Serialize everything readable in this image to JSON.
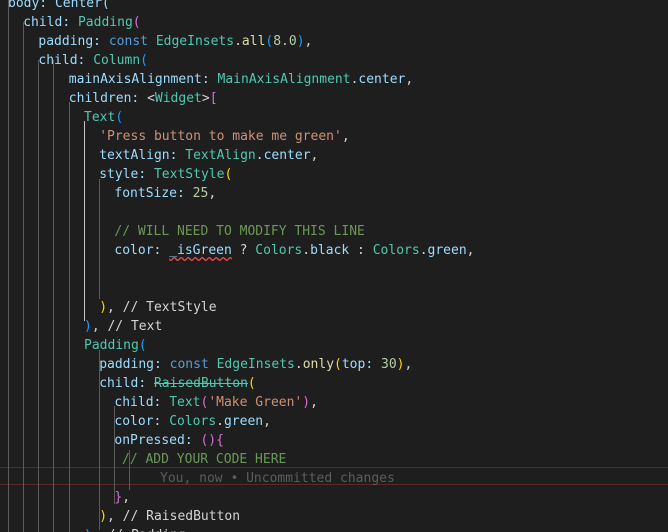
{
  "editor": {
    "language": "dart",
    "blame_annotation": "You, now • Uncommitted changes",
    "lines": [
      [
        {
          "t": "body: Center(",
          "c": "tok-prop"
        }
      ],
      [
        {
          "t": "child: ",
          "c": "tok-prop"
        },
        {
          "t": "Padding",
          "c": "tok-cls"
        },
        {
          "t": "(",
          "c": "tok-br2"
        }
      ],
      [
        {
          "t": "padding: ",
          "c": "tok-prop"
        },
        {
          "t": "const ",
          "c": "tok-kw"
        },
        {
          "t": "EdgeInsets",
          "c": "tok-cls"
        },
        {
          "t": ".",
          "c": "tok-punc"
        },
        {
          "t": "all",
          "c": "tok-fn"
        },
        {
          "t": "(",
          "c": "tok-br3"
        },
        {
          "t": "8.0",
          "c": "tok-num"
        },
        {
          "t": ")",
          "c": "tok-br3"
        },
        {
          "t": ",",
          "c": "tok-punc"
        }
      ],
      [
        {
          "t": "child: ",
          "c": "tok-prop"
        },
        {
          "t": "Column",
          "c": "tok-cls"
        },
        {
          "t": "(",
          "c": "tok-br3"
        }
      ],
      [
        {
          "t": "mainAxisAlignment: ",
          "c": "tok-prop"
        },
        {
          "t": "MainAxisAlignment",
          "c": "tok-cls"
        },
        {
          "t": ".",
          "c": "tok-punc"
        },
        {
          "t": "center",
          "c": "tok-prop"
        },
        {
          "t": ",",
          "c": "tok-punc"
        }
      ],
      [
        {
          "t": "children: ",
          "c": "tok-prop"
        },
        {
          "t": "<",
          "c": "tok-punc"
        },
        {
          "t": "Widget",
          "c": "tok-cls"
        },
        {
          "t": ">",
          "c": "tok-punc"
        },
        {
          "t": "[",
          "c": "tok-br2"
        }
      ],
      [
        {
          "t": "Text",
          "c": "tok-cls"
        },
        {
          "t": "(",
          "c": "tok-br3"
        }
      ],
      [
        {
          "t": "'Press button to make me green'",
          "c": "tok-str"
        },
        {
          "t": ",",
          "c": "tok-punc"
        }
      ],
      [
        {
          "t": "textAlign: ",
          "c": "tok-prop"
        },
        {
          "t": "TextAlign",
          "c": "tok-cls"
        },
        {
          "t": ".",
          "c": "tok-punc"
        },
        {
          "t": "center",
          "c": "tok-prop"
        },
        {
          "t": ",",
          "c": "tok-punc"
        }
      ],
      [
        {
          "t": "style: ",
          "c": "tok-prop"
        },
        {
          "t": "TextStyle",
          "c": "tok-cls"
        },
        {
          "t": "(",
          "c": "tok-br1"
        }
      ],
      [
        {
          "t": "fontSize: ",
          "c": "tok-prop"
        },
        {
          "t": "25",
          "c": "tok-num"
        },
        {
          "t": ",",
          "c": "tok-punc"
        }
      ],
      [],
      [
        {
          "t": "// WILL NEED TO MODIFY THIS LINE",
          "c": "tok-cmt"
        }
      ],
      [
        {
          "t": "color: ",
          "c": "tok-prop"
        },
        {
          "t": "_isGreen",
          "c": "tok-prop tok-err"
        },
        {
          "t": " ? ",
          "c": "tok-punc"
        },
        {
          "t": "Colors",
          "c": "tok-cls"
        },
        {
          "t": ".",
          "c": "tok-punc"
        },
        {
          "t": "black",
          "c": "tok-prop"
        },
        {
          "t": " : ",
          "c": "tok-punc"
        },
        {
          "t": "Colors",
          "c": "tok-cls"
        },
        {
          "t": ".",
          "c": "tok-punc"
        },
        {
          "t": "green",
          "c": "tok-prop"
        },
        {
          "t": ",",
          "c": "tok-punc"
        }
      ],
      [],
      [],
      [
        {
          "t": ")",
          "c": "tok-br1"
        },
        {
          "t": ", // TextStyle",
          "c": "tok-punc"
        }
      ],
      [
        {
          "t": ")",
          "c": "tok-br3"
        },
        {
          "t": ", // Text",
          "c": "tok-punc"
        }
      ],
      [
        {
          "t": "Padding",
          "c": "tok-cls"
        },
        {
          "t": "(",
          "c": "tok-br3"
        }
      ],
      [
        {
          "t": "padding: ",
          "c": "tok-prop"
        },
        {
          "t": "const ",
          "c": "tok-kw"
        },
        {
          "t": "EdgeInsets",
          "c": "tok-cls"
        },
        {
          "t": ".",
          "c": "tok-punc"
        },
        {
          "t": "only",
          "c": "tok-fn"
        },
        {
          "t": "(",
          "c": "tok-br1"
        },
        {
          "t": "top: ",
          "c": "tok-prop"
        },
        {
          "t": "30",
          "c": "tok-num"
        },
        {
          "t": ")",
          "c": "tok-br1"
        },
        {
          "t": ",",
          "c": "tok-punc"
        }
      ],
      [
        {
          "t": "child: ",
          "c": "tok-prop"
        },
        {
          "t": "RaisedButton",
          "c": "tok-cls tok-strike tok-warn"
        },
        {
          "t": "(",
          "c": "tok-br1"
        }
      ],
      [
        {
          "t": "child: ",
          "c": "tok-prop"
        },
        {
          "t": "Text",
          "c": "tok-cls"
        },
        {
          "t": "(",
          "c": "tok-br2"
        },
        {
          "t": "'Make Green'",
          "c": "tok-str"
        },
        {
          "t": ")",
          "c": "tok-br2"
        },
        {
          "t": ",",
          "c": "tok-punc"
        }
      ],
      [
        {
          "t": "color: ",
          "c": "tok-prop"
        },
        {
          "t": "Colors",
          "c": "tok-cls"
        },
        {
          "t": ".",
          "c": "tok-punc"
        },
        {
          "t": "green",
          "c": "tok-prop"
        },
        {
          "t": ",",
          "c": "tok-punc"
        }
      ],
      [
        {
          "t": "onPressed: ",
          "c": "tok-prop"
        },
        {
          "t": "()",
          "c": "tok-br2"
        },
        {
          "t": "{",
          "c": "tok-br2"
        }
      ],
      [
        {
          "t": "// ADD YOUR CODE HERE",
          "c": "tok-cmt"
        }
      ],
      [
        {
          "t": "You, now • Uncommitted changes",
          "c": "tok-blame"
        }
      ],
      [
        {
          "t": "}",
          "c": "tok-br2"
        },
        {
          "t": ",",
          "c": "tok-punc"
        }
      ],
      [
        {
          "t": ")",
          "c": "tok-br1"
        },
        {
          "t": ", // RaisedButton",
          "c": "tok-punc"
        }
      ],
      [
        {
          "t": ")",
          "c": "tok-br3"
        },
        {
          "t": ", // Padding",
          "c": "tok-punc"
        }
      ]
    ]
  }
}
